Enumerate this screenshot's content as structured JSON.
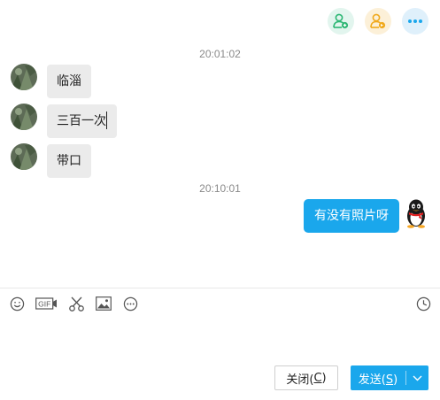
{
  "colors": {
    "accent": "#1aa7ec",
    "incoming_bubble": "#ebebeb",
    "timestamp": "#8a8a8a"
  },
  "header": {
    "buttons": [
      {
        "icon": "add-contact-icon",
        "color": "#2bb673"
      },
      {
        "icon": "share-contact-icon",
        "color": "#f0a91c"
      },
      {
        "icon": "more-icon",
        "color": "#1aa7ec"
      }
    ]
  },
  "chat": {
    "timestamp_1": "20:01:02",
    "messages_in": [
      {
        "text": "临淄"
      },
      {
        "text": "三百一次"
      },
      {
        "text": "带口"
      }
    ],
    "timestamp_2": "20:10:01",
    "message_out": {
      "text": "有没有照片呀"
    }
  },
  "toolbar": {
    "items": [
      "emoji-icon",
      "gif-icon",
      "screenshot-scissors-icon",
      "image-icon",
      "more-options-icon",
      "history-clock-icon"
    ],
    "gif_label": "GIF"
  },
  "input": {
    "value": ""
  },
  "actions": {
    "close_main": "关闭(",
    "close_key": "C",
    "close_end": ")",
    "send_main": "发送(",
    "send_key": "S",
    "send_end": ")"
  }
}
